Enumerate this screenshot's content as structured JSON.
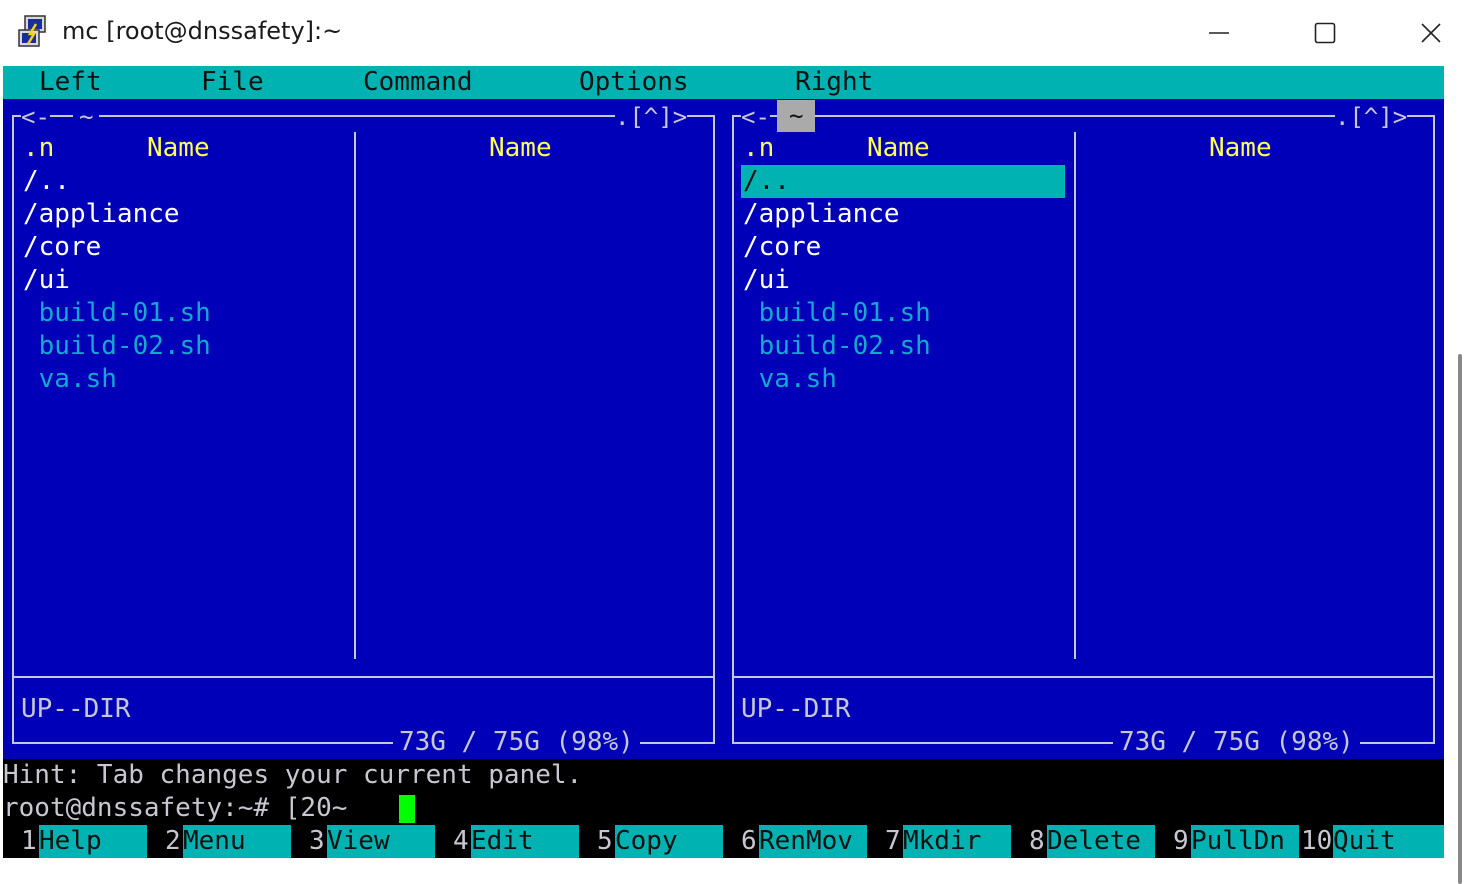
{
  "window": {
    "title": "mc [root@dnssafety]:~",
    "app_icon": "putty-icon",
    "controls": [
      "minimize-icon",
      "maximize-icon",
      "close-icon"
    ]
  },
  "menu": [
    "Left",
    "File",
    "Command",
    "Options",
    "Right"
  ],
  "panels": {
    "left": {
      "path": "~",
      "top_right": ".[^]>",
      "top_left": "<-",
      "columns": [
        ".n",
        "Name",
        "Name"
      ],
      "entries": [
        {
          "name": "/..",
          "type": "dir"
        },
        {
          "name": "/appliance",
          "type": "dir"
        },
        {
          "name": "/core",
          "type": "dir"
        },
        {
          "name": "/ui",
          "type": "dir"
        },
        {
          "name": " build-01.sh",
          "type": "file"
        },
        {
          "name": " build-02.sh",
          "type": "file"
        },
        {
          "name": " va.sh",
          "type": "file"
        }
      ],
      "status": "UP--DIR",
      "disk": "73G / 75G (98%)"
    },
    "right": {
      "path": "~",
      "top_right": ".[^]>",
      "top_left": "<-",
      "columns": [
        ".n",
        "Name",
        "Name"
      ],
      "entries": [
        {
          "name": "/..",
          "type": "dir",
          "selected": true
        },
        {
          "name": "/appliance",
          "type": "dir"
        },
        {
          "name": "/core",
          "type": "dir"
        },
        {
          "name": "/ui",
          "type": "dir"
        },
        {
          "name": " build-01.sh",
          "type": "file"
        },
        {
          "name": " build-02.sh",
          "type": "file"
        },
        {
          "name": " va.sh",
          "type": "file"
        }
      ],
      "status": "UP--DIR",
      "disk": "73G / 75G (98%)"
    }
  },
  "hint": "Hint: Tab changes your current panel.",
  "prompt": "root@dnssafety:~# [20~",
  "fkeys": [
    {
      "num": "1",
      "label": "Help"
    },
    {
      "num": "2",
      "label": "Menu"
    },
    {
      "num": "3",
      "label": "View"
    },
    {
      "num": "4",
      "label": "Edit"
    },
    {
      "num": "5",
      "label": "Copy"
    },
    {
      "num": "6",
      "label": "RenMov"
    },
    {
      "num": "7",
      "label": "Mkdir"
    },
    {
      "num": "8",
      "label": "Delete"
    },
    {
      "num": "9",
      "label": "PullDn"
    },
    {
      "num": "10",
      "label": "Quit"
    }
  ],
  "colors": {
    "panel_bg": "#0000b8",
    "menu_bg": "#00b2b2",
    "header_text": "#ffff55",
    "file_text": "#14a8d0",
    "dir_text": "#ffffff",
    "cursor": "#00ff00"
  }
}
